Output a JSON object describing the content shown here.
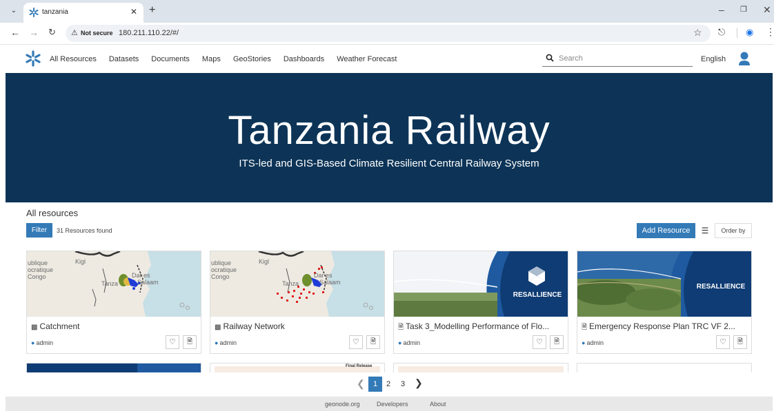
{
  "browser": {
    "tab_title": "tanzania",
    "not_secure_label": "Not secure",
    "url": "180.211.110.22/#/"
  },
  "nav": {
    "links": [
      "All Resources",
      "Datasets",
      "Documents",
      "Maps",
      "GeoStories",
      "Dashboards",
      "Weather Forecast"
    ],
    "search_placeholder": "Search",
    "language": "English"
  },
  "hero": {
    "title": "Tanzania Railway",
    "subtitle": "ITS-led and GIS-Based Climate Resilient Central Railway System"
  },
  "resources": {
    "heading": "All resources",
    "filter_label": "Filter",
    "count_text": "31 Resources found",
    "add_label": "Add Resource",
    "order_label": "Order by"
  },
  "cards": [
    {
      "title": "Catchment",
      "owner": "admin",
      "type": "map",
      "map_labels": [
        "ublique",
        "ocratique",
        "Congo",
        "Kigl",
        "Tanza",
        "Dar es",
        "Salaam"
      ]
    },
    {
      "title": "Railway Network",
      "owner": "admin",
      "type": "map",
      "map_labels": [
        "ublique",
        "ocratique",
        "Congo",
        "Kigl",
        "Tanza",
        "Dar es",
        "Salaam"
      ]
    },
    {
      "title": "Task 3_Modelling Performance of Flo...",
      "owner": "admin",
      "type": "document",
      "brand": "RESALLIENCE"
    },
    {
      "title": "Emergency Response Plan TRC VF 2...",
      "owner": "admin",
      "type": "document",
      "brand": "RESALLIENCE"
    }
  ],
  "second_row": {
    "label": "Final Release"
  },
  "pagination": {
    "pages": [
      "1",
      "2",
      "3"
    ],
    "current": "1"
  },
  "footer": {
    "links": [
      "geonode.org",
      "Developers",
      "About"
    ]
  },
  "colors": {
    "hero_bg": "#0d3457",
    "accent": "#337ab7",
    "brand_blue": "#0f3c74"
  }
}
